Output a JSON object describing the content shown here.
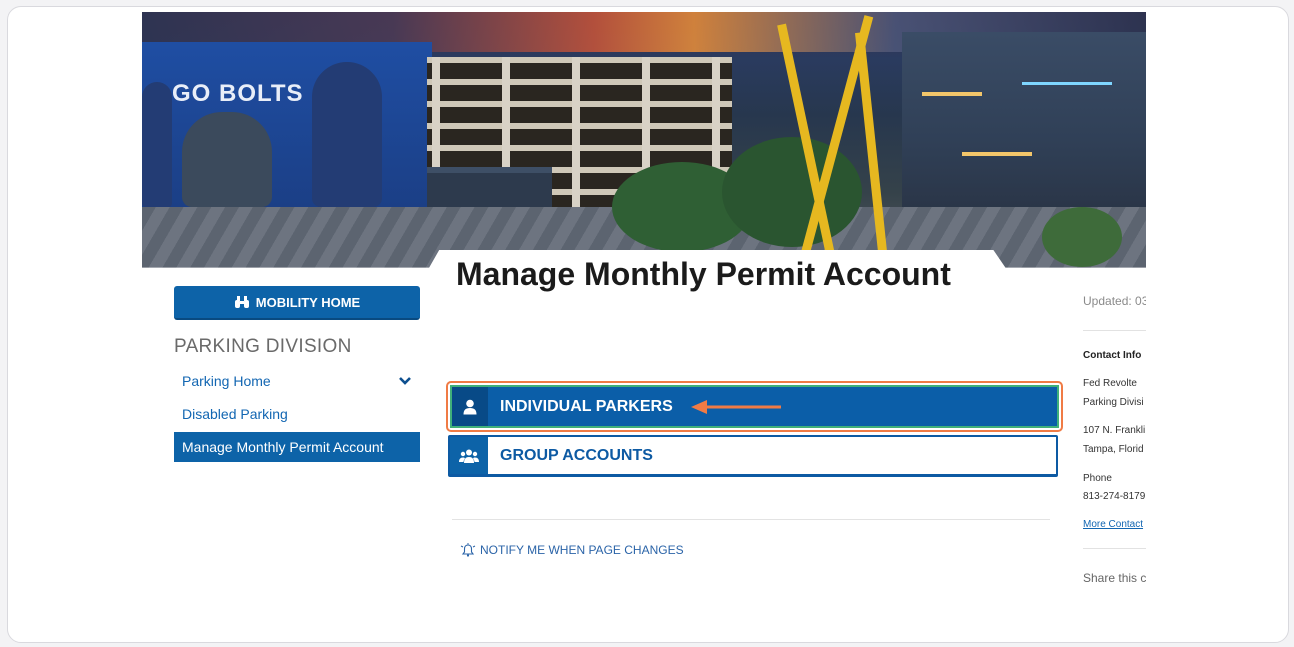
{
  "page": {
    "title": "Manage Monthly Permit Account"
  },
  "hero": {
    "mural_text": "GO BOLTS"
  },
  "sidebar": {
    "home_button": {
      "label": "MOBILITY HOME",
      "icon": "binoculars-icon"
    },
    "division_title": "PARKING DIVISION",
    "items": [
      {
        "label": "Parking Home",
        "expandable": true,
        "active": false
      },
      {
        "label": "Disabled Parking",
        "expandable": false,
        "active": false
      },
      {
        "label": "Manage Monthly Permit Account",
        "expandable": false,
        "active": true
      }
    ]
  },
  "main": {
    "buttons": [
      {
        "label": "INDIVIDUAL PARKERS",
        "icon": "user-icon",
        "highlighted": true
      },
      {
        "label": "GROUP ACCOUNTS",
        "icon": "users-icon",
        "highlighted": false
      }
    ],
    "notify_label": "NOTIFY ME WHEN PAGE CHANGES"
  },
  "right_column": {
    "updated": "Updated: 03",
    "contact_heading": "Contact Info",
    "contact_lines": [
      "Fed Revolte",
      "Parking Divisi",
      "107 N. Frankli",
      "Tampa, Florid",
      "Phone",
      "813-274-8179"
    ],
    "more_contact": "More Contact",
    "share": "Share this c"
  },
  "colors": {
    "primary_blue": "#0d63a8",
    "highlight_orange": "#f07b45",
    "highlight_green": "#40b07a"
  }
}
